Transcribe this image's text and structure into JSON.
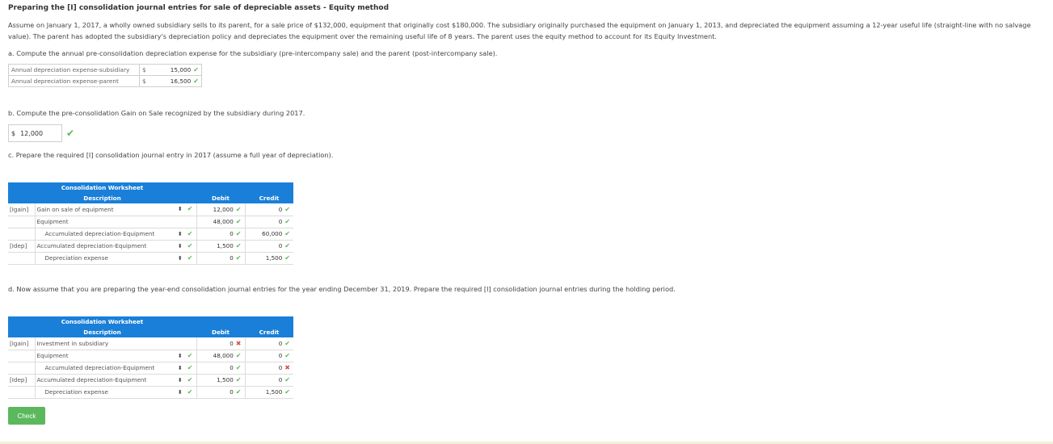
{
  "title": "Preparing the [I] consolidation journal entries for sale of depreciable assets - Equity method",
  "intro": "Assume on January 1, 2017, a wholly owned subsidiary sells to its parent, for a sale price of $132,000, equipment that originally cost $180,000. The subsidiary originally purchased the equipment on January 1, 2013, and depreciated the equipment assuming a 12-year useful life (straight-line with no salvage value). The parent has adopted the subsidiary's depreciation policy and depreciates the equipment over the remaining useful life of 8 years. The parent uses the equity method to account for its Equity Investment.",
  "part_a": {
    "question": "a. Compute the annual pre-consolidation depreciation expense for the subsidiary (pre-intercompany sale) and the parent (post-intercompany sale).",
    "rows": [
      {
        "label": "Annual depreciation expense-subsidiary",
        "currency": "$",
        "value": "15,000",
        "mark": "✔"
      },
      {
        "label": "Annual depreciation expense-parent",
        "currency": "$",
        "value": "16,500",
        "mark": "✔"
      }
    ]
  },
  "part_b": {
    "question": "b. Compute the pre-consolidation Gain on Sale recognized by the subsidiary during 2017.",
    "currency": "$",
    "value": "12,000",
    "mark": "✔"
  },
  "part_c": {
    "question": "c. Prepare the required [I] consolidation journal entry in 2017 (assume a full year of depreciation).",
    "worksheet_title": "Consolidation Worksheet",
    "headers": {
      "description": "Description",
      "debit": "Debit",
      "credit": "Credit"
    },
    "rows": [
      {
        "code": "[Igain]",
        "desc": "Gain on sale of equipment",
        "indent": false,
        "dropdown": true,
        "debit": "12,000",
        "debit_mark": "✔",
        "credit": "0",
        "credit_mark": "✔"
      },
      {
        "code": "",
        "desc": "Equipment",
        "indent": false,
        "dropdown": false,
        "debit": "48,000",
        "debit_mark": "✔",
        "credit": "0",
        "credit_mark": "✔"
      },
      {
        "code": "",
        "desc": "Accumulated depreciation-Equipment",
        "indent": true,
        "dropdown": true,
        "debit": "0",
        "debit_mark": "✔",
        "credit": "60,000",
        "credit_mark": "✔"
      },
      {
        "code": "[Idep]",
        "desc": "Accumulated depreciation-Equipment",
        "indent": false,
        "dropdown": true,
        "debit": "1,500",
        "debit_mark": "✔",
        "credit": "0",
        "credit_mark": "✔"
      },
      {
        "code": "",
        "desc": "Depreciation expense",
        "indent": true,
        "dropdown": true,
        "debit": "0",
        "debit_mark": "✔",
        "credit": "1,500",
        "credit_mark": "✔"
      }
    ]
  },
  "part_d": {
    "question": "d. Now assume that you are preparing the year-end consolidation journal entries for the year ending December 31, 2019. Prepare the required [I] consolidation journal entries during the holding period.",
    "worksheet_title": "Consolidation Worksheet",
    "headers": {
      "description": "Description",
      "debit": "Debit",
      "credit": "Credit"
    },
    "rows": [
      {
        "code": "[Igain]",
        "desc": "Investment in subsidiary",
        "indent": false,
        "dropdown": false,
        "debit": "0",
        "debit_mark": "✖",
        "credit": "0",
        "credit_mark": "✔"
      },
      {
        "code": "",
        "desc": "Equipment",
        "indent": false,
        "dropdown": true,
        "debit": "48,000",
        "debit_mark": "✔",
        "credit": "0",
        "credit_mark": "✔"
      },
      {
        "code": "",
        "desc": "Accumulated depreciation-Equipment",
        "indent": true,
        "dropdown": true,
        "debit": "0",
        "debit_mark": "✔",
        "credit": "0",
        "credit_mark": "✖"
      },
      {
        "code": "[Idep]",
        "desc": "Accumulated depreciation-Equipment",
        "indent": false,
        "dropdown": true,
        "debit": "1,500",
        "debit_mark": "✔",
        "credit": "0",
        "credit_mark": "✔"
      },
      {
        "code": "",
        "desc": "Depreciation expense",
        "indent": true,
        "dropdown": true,
        "debit": "0",
        "debit_mark": "✔",
        "credit": "1,500",
        "credit_mark": "✔"
      }
    ]
  },
  "dropdown_glyph": "⬍",
  "select_mark": "✔",
  "check_button": "Check",
  "colors": {
    "header_blue": "#1a7fd8",
    "correct_green": "#5cb85c",
    "incorrect_red": "#d9534f"
  }
}
